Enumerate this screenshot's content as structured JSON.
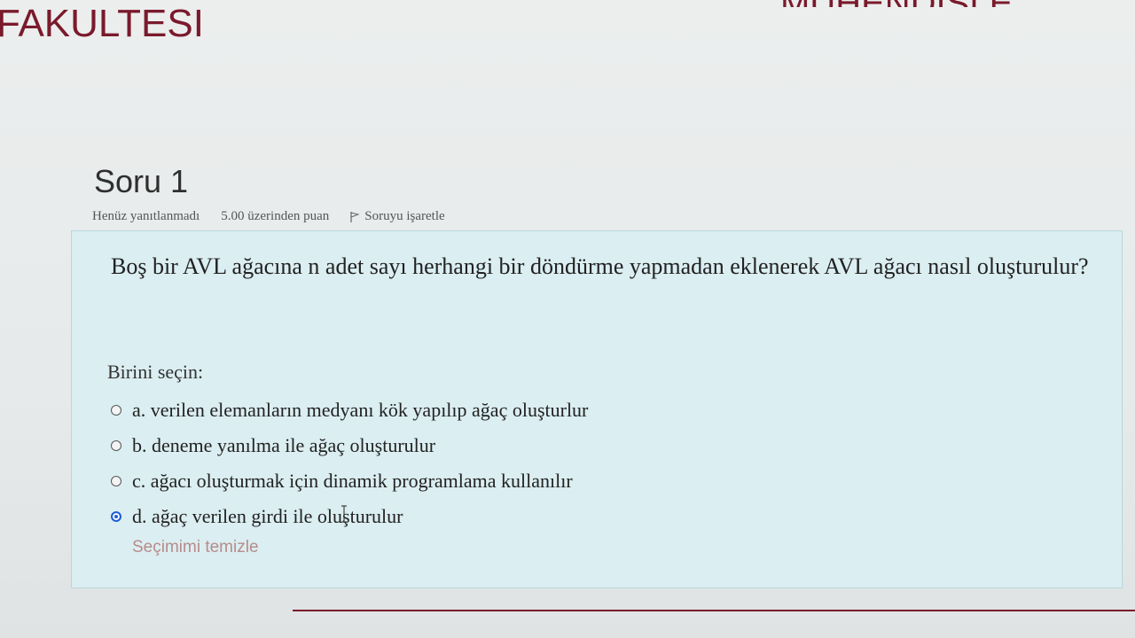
{
  "header": {
    "title": "FAKULTESI",
    "right_partial": "MÜHENDİSLE"
  },
  "question": {
    "heading": "Soru 1",
    "status": "Henüz yanıtlanmadı",
    "points": "5.00 üzerinden puan",
    "flag_label": "Soruyu işaretle",
    "text": "Boş bir AVL ağacına n adet sayı herhangi bir döndürme yapmadan eklenerek AVL ağacı nasıl oluşturulur?",
    "prompt": "Birini seçin:",
    "options": [
      {
        "label": "a. verilen elemanların medyanı kök yapılıp ağaç oluşturlur",
        "checked": false
      },
      {
        "label": "b. deneme yanılma ile ağaç oluşturulur",
        "checked": false
      },
      {
        "label": "c. ağacı oluşturmak için dinamik programlama kullanılır",
        "checked": false
      },
      {
        "label": "d. ağaç verilen girdi ile oluşturulur",
        "checked": true
      }
    ],
    "clear_label": "Seçimimi temizle"
  },
  "colors": {
    "brand": "#7a1a2c",
    "box_bg": "#dbeef1",
    "radio_checked": "#1f5fd6"
  }
}
